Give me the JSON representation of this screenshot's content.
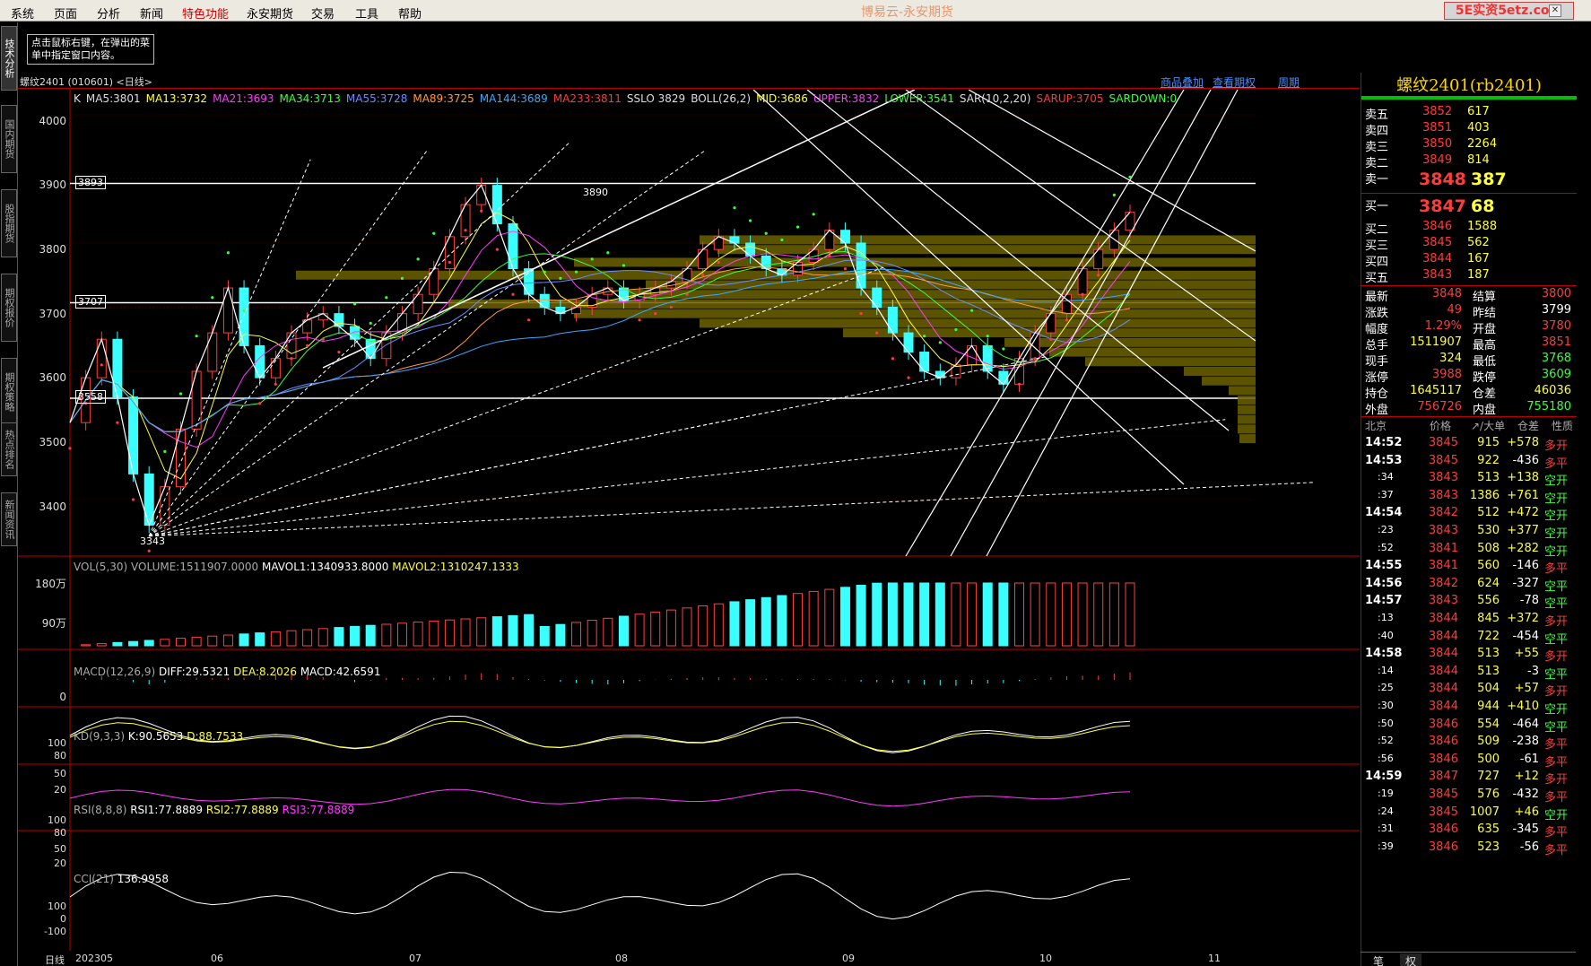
{
  "menu": {
    "items": [
      "系统",
      "页面",
      "分析",
      "新闻",
      "特色功能",
      "永安期货",
      "交易",
      "工具",
      "帮助"
    ],
    "app_title": "博易云-永安期货",
    "watermark": "5E实资5etz.com"
  },
  "left_tabs": [
    "技术分析",
    "国内期货",
    "股指期货",
    "期权报价",
    "期权策略",
    "热点排名",
    "新闻资讯"
  ],
  "tooltip": "点击鼠标右键，在弹出的菜单中指定窗口内容。",
  "header": {
    "symbol": "螺纹2401 (010601) <日线>",
    "links": [
      "商品叠加",
      "查看期权",
      "周期"
    ]
  },
  "main_indicators": [
    {
      "t": "K",
      "c": "#ddd"
    },
    {
      "t": "MA5:3801",
      "c": "#ddd"
    },
    {
      "t": "MA13:3732",
      "c": "#ffff3b"
    },
    {
      "t": "MA21:3693",
      "c": "#ff3bff"
    },
    {
      "t": "MA34:3713",
      "c": "#3bff3b"
    },
    {
      "t": "MA55:3728",
      "c": "#6a8cff"
    },
    {
      "t": "MA89:3725",
      "c": "#ff9a3b"
    },
    {
      "t": "MA144:3689",
      "c": "#3ba7ff"
    },
    {
      "t": "MA233:3811",
      "c": "#ff3b3b"
    },
    {
      "t": "SSLO 3829",
      "c": "#ddd"
    },
    {
      "t": "BOLL(26,2)",
      "c": "#ddd"
    },
    {
      "t": "MID:3686",
      "c": "#ffff3b"
    },
    {
      "t": "UPPER:3832",
      "c": "#ff3bff"
    },
    {
      "t": "LOWER:3541",
      "c": "#3bff3b"
    },
    {
      "t": "SAR(10,2,20)",
      "c": "#ddd"
    },
    {
      "t": "SARUP:3705",
      "c": "#ff3b3b"
    },
    {
      "t": "SARDOWN:0",
      "c": "#3bff3b"
    }
  ],
  "price_axis": [
    "4000",
    "3900",
    "3800",
    "3700",
    "3600",
    "3500",
    "3400"
  ],
  "price_marks": [
    "3893",
    "3707",
    "3558"
  ],
  "chart_labels": {
    "high": "3890",
    "low": "3343"
  },
  "vol_panel": {
    "label": "VOL(5,30)",
    "volume": "VOLUME:1511907.0000",
    "mavol1": "MAVOL1:1340933.8000",
    "mavol2": "MAVOL2:1310247.1333",
    "axis": [
      "180万",
      "90万"
    ]
  },
  "macd_panel": {
    "label": "MACD(12,26,9)",
    "diff": "DIFF:29.5321",
    "dea": "DEA:8.2026",
    "macd": "MACD:42.6591",
    "axis": [
      "0"
    ]
  },
  "kd_panel": {
    "label": "KD(9,3,3)",
    "k": "K:90.5653",
    "d": "D:88.7533",
    "axis": [
      "100",
      "80",
      "50",
      "20"
    ]
  },
  "rsi_panel": {
    "label": "RSI(8,8,8)",
    "rsi1": "RSI1:77.8889",
    "rsi2": "RSI2:77.8889",
    "rsi3": "RSI3:77.8889",
    "axis": [
      "100",
      "80",
      "50",
      "20"
    ]
  },
  "cci_panel": {
    "label": "CCI(21)",
    "value": "136.9958",
    "axis": [
      "100",
      "0",
      "-100"
    ]
  },
  "time_axis": {
    "period": "日线",
    "labels": [
      "202305",
      "06",
      "07",
      "08",
      "09",
      "10",
      "11"
    ]
  },
  "quote": {
    "title": "螺纹2401(rb2401)",
    "sell": [
      {
        "l": "卖五",
        "p": "3852",
        "v": "617"
      },
      {
        "l": "卖四",
        "p": "3851",
        "v": "403"
      },
      {
        "l": "卖三",
        "p": "3850",
        "v": "2264"
      },
      {
        "l": "卖二",
        "p": "3849",
        "v": "814"
      },
      {
        "l": "卖一",
        "p": "3848",
        "v": "387"
      }
    ],
    "buy": [
      {
        "l": "买一",
        "p": "3847",
        "v": "68"
      },
      {
        "l": "买二",
        "p": "3846",
        "v": "1588"
      },
      {
        "l": "买三",
        "p": "3845",
        "v": "562"
      },
      {
        "l": "买四",
        "p": "3844",
        "v": "167"
      },
      {
        "l": "买五",
        "p": "3843",
        "v": "187"
      }
    ],
    "stats": [
      [
        "最新",
        "3848",
        "结算",
        "3800"
      ],
      [
        "涨跌",
        "49",
        "昨结",
        "3799"
      ],
      [
        "幅度",
        "1.29%",
        "开盘",
        "3780"
      ],
      [
        "总手",
        "1511907",
        "最高",
        "3851"
      ],
      [
        "现手",
        "324",
        "最低",
        "3768"
      ],
      [
        "涨停",
        "3988",
        "跌停",
        "3609"
      ],
      [
        "持仓",
        "1645117",
        "仓差",
        "46036"
      ],
      [
        "外盘",
        "756726",
        "内盘",
        "755180"
      ]
    ],
    "tick_header": [
      "北京",
      "价格",
      "↗/大单",
      "仓差",
      "性质"
    ],
    "ticks": [
      [
        "14:52",
        "3845",
        "915",
        "+578",
        "多开"
      ],
      [
        "14:53",
        "3845",
        "922",
        "-436",
        "多平"
      ],
      [
        ":34",
        "3843",
        "513",
        "+138",
        "空开"
      ],
      [
        ":37",
        "3843",
        "1386",
        "+761",
        "空开"
      ],
      [
        "14:54",
        "3842",
        "512",
        "+472",
        "空开"
      ],
      [
        ":23",
        "3843",
        "530",
        "+377",
        "空开"
      ],
      [
        ":52",
        "3841",
        "508",
        "+282",
        "空开"
      ],
      [
        "14:55",
        "3841",
        "560",
        "-146",
        "多平"
      ],
      [
        "14:56",
        "3842",
        "624",
        "-327",
        "空平"
      ],
      [
        "14:57",
        "3843",
        "556",
        "-78",
        "空平"
      ],
      [
        ":13",
        "3844",
        "845",
        "+372",
        "多开"
      ],
      [
        ":40",
        "3844",
        "722",
        "-454",
        "空平"
      ],
      [
        "14:58",
        "3844",
        "513",
        "+55",
        "多开"
      ],
      [
        ":14",
        "3844",
        "513",
        "-3",
        "空平"
      ],
      [
        ":25",
        "3844",
        "504",
        "+57",
        "多开"
      ],
      [
        ":30",
        "3844",
        "944",
        "+410",
        "空开"
      ],
      [
        ":50",
        "3846",
        "554",
        "-464",
        "空平"
      ],
      [
        ":52",
        "3846",
        "509",
        "-238",
        "多平"
      ],
      [
        ":56",
        "3846",
        "500",
        "-61",
        "多平"
      ],
      [
        "14:59",
        "3847",
        "727",
        "+12",
        "多开"
      ],
      [
        ":19",
        "3845",
        "576",
        "-432",
        "多平"
      ],
      [
        ":24",
        "3845",
        "1007",
        "+46",
        "空开"
      ],
      [
        ":31",
        "3846",
        "635",
        "-345",
        "多平"
      ],
      [
        ":39",
        "3846",
        "523",
        "-56",
        "多平"
      ]
    ],
    "bottom_tabs": [
      "笔",
      "权"
    ]
  }
}
